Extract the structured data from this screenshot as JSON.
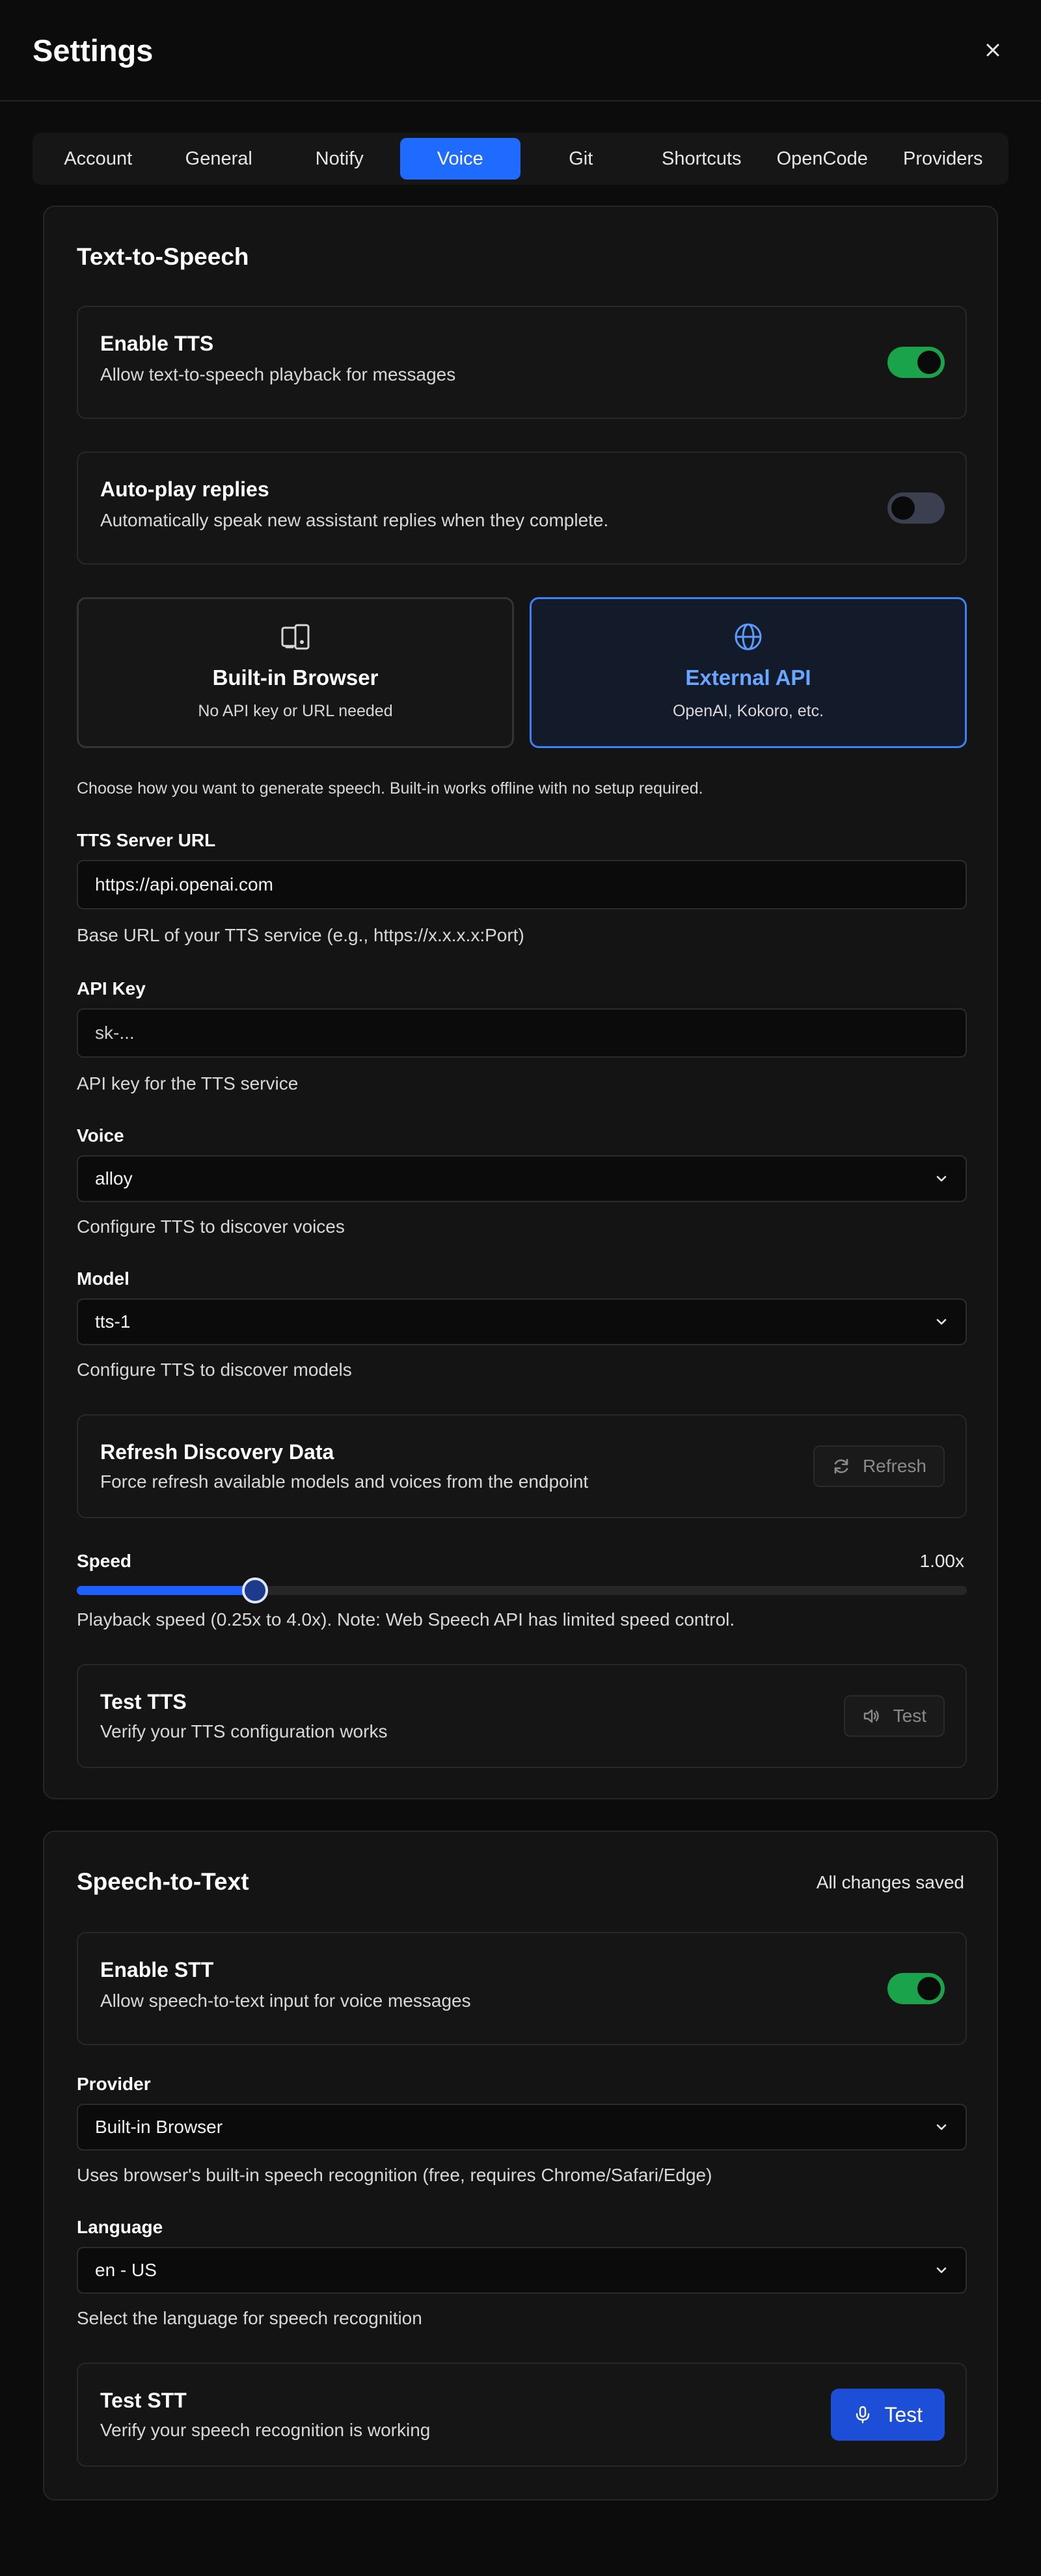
{
  "header": {
    "title": "Settings",
    "close_icon": "close-icon"
  },
  "tabs": [
    {
      "label": "Account"
    },
    {
      "label": "General"
    },
    {
      "label": "Notify"
    },
    {
      "label": "Voice"
    },
    {
      "label": "Git"
    },
    {
      "label": "Shortcuts"
    },
    {
      "label": "OpenCode"
    },
    {
      "label": "Providers"
    }
  ],
  "active_tab": "Voice",
  "tts": {
    "title": "Text-to-Speech",
    "enable": {
      "title": "Enable TTS",
      "desc": "Allow text-to-speech playback for messages",
      "on": true
    },
    "autoplay": {
      "title": "Auto-play replies",
      "desc": "Automatically speak new assistant replies when they complete.",
      "on": false
    },
    "modes": {
      "browser": {
        "title": "Built-in Browser",
        "sub": "No API key or URL needed",
        "icon": "devices-icon"
      },
      "external": {
        "title": "External API",
        "sub": "OpenAI, Kokoro, etc.",
        "icon": "globe-icon",
        "selected": true
      }
    },
    "mode_help": "Choose how you want to generate speech. Built-in works offline with no setup required.",
    "server_url": {
      "label": "TTS Server URL",
      "value": "https://api.openai.com",
      "help": "Base URL of your TTS service (e.g., https://x.x.x.x:Port)"
    },
    "api_key": {
      "label": "API Key",
      "placeholder": "sk-...",
      "help": "API key for the TTS service"
    },
    "voice": {
      "label": "Voice",
      "value": "alloy",
      "help": "Configure TTS to discover voices"
    },
    "model": {
      "label": "Model",
      "value": "tts-1",
      "help": "Configure TTS to discover models"
    },
    "refresh": {
      "title": "Refresh Discovery Data",
      "desc": "Force refresh available models and voices from the endpoint",
      "button": "Refresh"
    },
    "speed": {
      "label": "Speed",
      "value_text": "1.00x",
      "value": 1.0,
      "min": 0.25,
      "max": 4.0,
      "help": "Playback speed (0.25x to 4.0x). Note: Web Speech API has limited speed control."
    },
    "test": {
      "title": "Test TTS",
      "desc": "Verify your TTS configuration works",
      "button": "Test"
    }
  },
  "stt": {
    "title": "Speech-to-Text",
    "status": "All changes saved",
    "enable": {
      "title": "Enable STT",
      "desc": "Allow speech-to-text input for voice messages",
      "on": true
    },
    "provider": {
      "label": "Provider",
      "value": "Built-in Browser",
      "help": "Uses browser's built-in speech recognition (free, requires Chrome/Safari/Edge)"
    },
    "language": {
      "label": "Language",
      "value": "en - US",
      "help": "Select the language for speech recognition"
    },
    "test": {
      "title": "Test STT",
      "desc": "Verify your speech recognition is working",
      "button": "Test"
    }
  },
  "colors": {
    "accent": "#1f6bff",
    "toggle_on": "#1aa34a",
    "selected_border": "#3b82f6",
    "primary_button": "#1d4ed8"
  }
}
